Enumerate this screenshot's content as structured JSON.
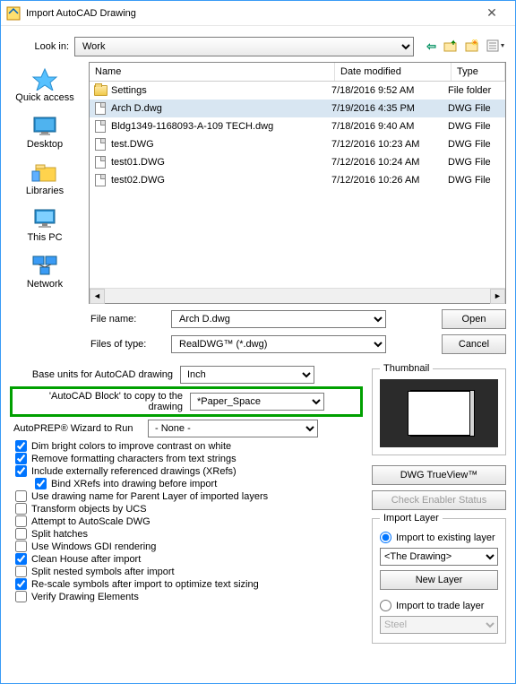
{
  "window": {
    "title": "Import AutoCAD Drawing"
  },
  "lookin": {
    "label": "Look in:",
    "value": "Work"
  },
  "nav": {
    "back": "←",
    "up": "folder-up",
    "new": "folder-new",
    "view": "view-menu"
  },
  "places": [
    {
      "label": "Quick access"
    },
    {
      "label": "Desktop"
    },
    {
      "label": "Libraries"
    },
    {
      "label": "This PC"
    },
    {
      "label": "Network"
    }
  ],
  "columns": {
    "name": "Name",
    "date": "Date modified",
    "type": "Type"
  },
  "files": [
    {
      "name": "Settings",
      "date": "7/18/2016 9:52 AM",
      "type": "File folder",
      "kind": "folder"
    },
    {
      "name": "Arch D.dwg",
      "date": "7/19/2016 4:35 PM",
      "type": "DWG File",
      "kind": "file",
      "selected": true
    },
    {
      "name": "Bldg1349-1168093-A-109 TECH.dwg",
      "date": "7/18/2016 9:40 AM",
      "type": "DWG File",
      "kind": "file"
    },
    {
      "name": "test.DWG",
      "date": "7/12/2016 10:23 AM",
      "type": "DWG File",
      "kind": "file"
    },
    {
      "name": "test01.DWG",
      "date": "7/12/2016 10:24 AM",
      "type": "DWG File",
      "kind": "file"
    },
    {
      "name": "test02.DWG",
      "date": "7/12/2016 10:26 AM",
      "type": "DWG File",
      "kind": "file"
    }
  ],
  "filename": {
    "label": "File name:",
    "value": "Arch D.dwg"
  },
  "filetype": {
    "label": "Files of type:",
    "value": "RealDWG™ (*.dwg)"
  },
  "buttons": {
    "open": "Open",
    "cancel": "Cancel"
  },
  "baseunits": {
    "label": "Base units for AutoCAD drawing",
    "value": "Inch"
  },
  "block": {
    "label": "'AutoCAD Block' to copy to the drawing",
    "value": "*Paper_Space"
  },
  "wizard": {
    "label": "AutoPREP® Wizard to Run",
    "value": "- None -"
  },
  "checks": [
    {
      "label": "Dim bright colors to improve contrast on white",
      "checked": true
    },
    {
      "label": "Remove formatting characters from text strings",
      "checked": true
    },
    {
      "label": "Include externally referenced drawings (XRefs)",
      "checked": true
    },
    {
      "label": "Bind XRefs into drawing before import",
      "checked": true,
      "indent": true
    },
    {
      "label": "Use drawing name for Parent Layer of imported layers",
      "checked": false
    },
    {
      "label": "Transform objects by UCS",
      "checked": false
    },
    {
      "label": "Attempt to AutoScale DWG",
      "checked": false
    },
    {
      "label": "Split hatches",
      "checked": false
    },
    {
      "label": "Use Windows GDI rendering",
      "checked": false
    },
    {
      "label": "Clean House after import",
      "checked": true
    },
    {
      "label": "Split nested symbols after import",
      "checked": false
    },
    {
      "label": "Re-scale symbols after import to optimize text sizing",
      "checked": true
    },
    {
      "label": "Verify Drawing Elements",
      "checked": false
    }
  ],
  "thumbnail": {
    "legend": "Thumbnail"
  },
  "sidebtns": {
    "trueview": "DWG TrueView™",
    "enabler": "Check Enabler Status"
  },
  "importlayer": {
    "legend": "Import Layer",
    "existing": "Import to existing layer",
    "existing_sel": "<The Drawing>",
    "newlayer": "New Layer",
    "trade": "Import to trade layer",
    "trade_sel": "Steel"
  }
}
